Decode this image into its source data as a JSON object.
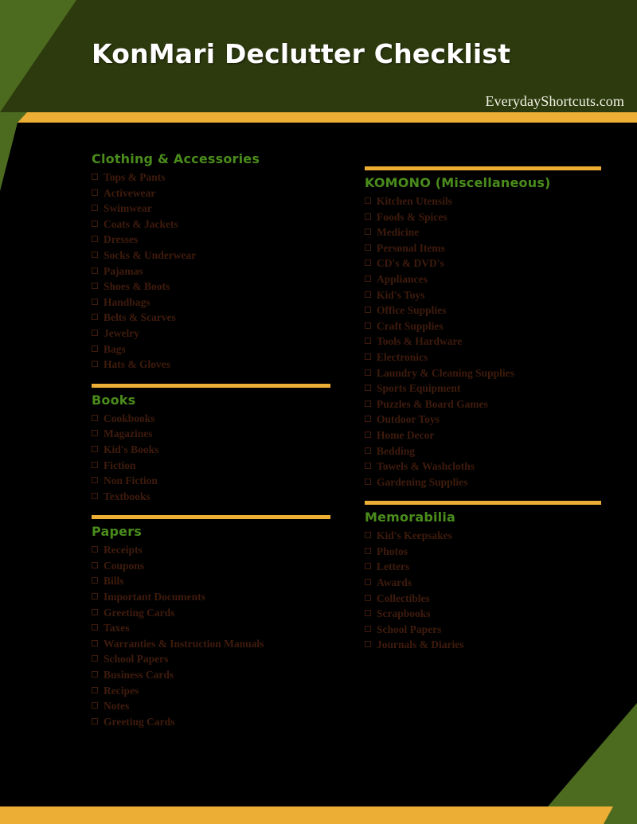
{
  "header": {
    "title": "KonMari Declutter Checklist",
    "site": "EverydayShortcuts.com"
  },
  "colors": {
    "page_background": "#000000",
    "banner_dark_green": "#2d3a0e",
    "accent_light_green": "#4c6b1f",
    "accent_orange": "#edae36",
    "section_title_green": "#4a8c1c",
    "item_text_brown": "#3f1b0c",
    "title_white": "#ffffff"
  },
  "icons": {
    "checkbox": "checkbox-empty-icon"
  },
  "columns": {
    "left": [
      {
        "title": "Clothing & Accessories",
        "has_divider": false,
        "items": [
          "Tops & Pants",
          "Activewear",
          "Swimwear",
          "Coats & Jackets",
          "Dresses",
          "Socks & Underwear",
          "Pajamas",
          "Shoes & Boots",
          "Handbags",
          "Belts & Scarves",
          "Jewelry",
          "Bags",
          "Hats & Gloves"
        ]
      },
      {
        "title": "Books",
        "has_divider": true,
        "items": [
          "Cookbooks",
          "Magazines",
          "Kid's Books",
          "Fiction",
          "Non Fiction",
          "Textbooks"
        ]
      },
      {
        "title": "Papers",
        "has_divider": true,
        "items": [
          "Receipts",
          "Coupons",
          "Bills",
          "Important Documents",
          "Greeting Cards",
          "Taxes",
          "Warranties & Instruction Manuals",
          "School Papers",
          "Business Cards",
          "Recipes",
          "Notes",
          "Greeting Cards"
        ]
      }
    ],
    "right": [
      {
        "title": "KOMONO (Miscellaneous)",
        "has_divider": true,
        "items": [
          "Kitchen Utensils",
          "Foods & Spices",
          "Medicine",
          "Personal Items",
          "CD's & DVD's",
          "Appliances",
          "Kid's Toys",
          "Office Supplies",
          "Craft Supplies",
          "Tools & Hardware",
          "Electronics",
          "Laundry & Cleaning Supplies",
          "Sports Equipment",
          "Puzzles & Board Games",
          "Outdoor Toys",
          "Home Decor",
          "Bedding",
          "Towels & Washcloths",
          "Gardening Supplies"
        ]
      },
      {
        "title": "Memorabilia",
        "has_divider": true,
        "items": [
          "Kid's Keepsakes",
          "Photos",
          "Letters",
          "Awards",
          "Collectibles",
          "Scrapbooks",
          "School Papers",
          "Journals & Diaries"
        ]
      }
    ]
  }
}
